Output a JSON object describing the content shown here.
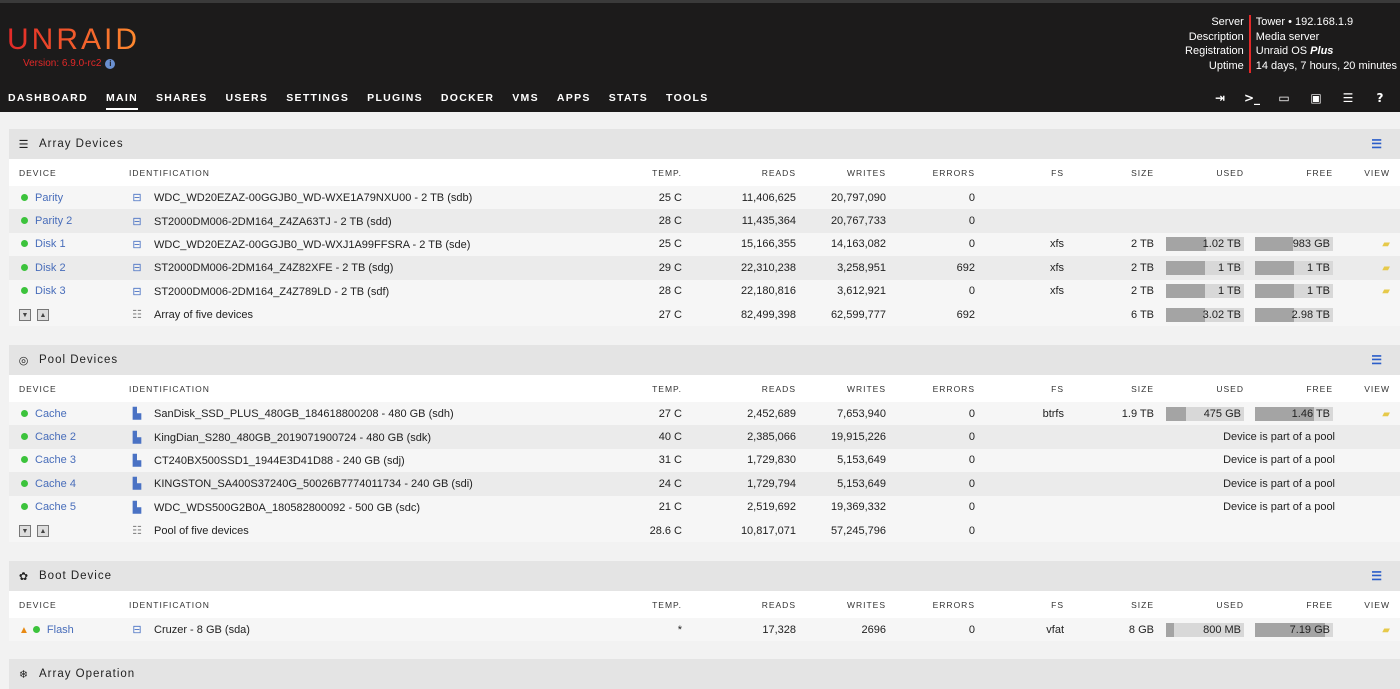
{
  "header": {
    "logo": "UNRAID",
    "version": "Version: 6.9.0-rc2",
    "server_labels": [
      "Server",
      "Description",
      "Registration",
      "Uptime"
    ],
    "server_values": [
      "Tower • 192.168.1.9",
      "Media server",
      "Unraid OS ",
      "14 days, 7 hours, 20 minutes"
    ],
    "registration_emphasis": "Plus"
  },
  "nav": {
    "items": [
      "DASHBOARD",
      "MAIN",
      "SHARES",
      "USERS",
      "SETTINGS",
      "PLUGINS",
      "DOCKER",
      "VMS",
      "APPS",
      "STATS",
      "TOOLS"
    ],
    "active": "MAIN",
    "icons": [
      "logout-icon",
      "terminal-icon",
      "feedback-icon",
      "webgui-icon",
      "log-icon",
      "help-icon"
    ]
  },
  "columns": [
    "DEVICE",
    "IDENTIFICATION",
    "TEMP.",
    "READS",
    "WRITES",
    "ERRORS",
    "FS",
    "SIZE",
    "USED",
    "FREE",
    "VIEW"
  ],
  "array": {
    "title": "Array Devices",
    "rows": [
      {
        "device": "Parity",
        "id": "WDC_WD20EZAZ-00GGJB0_WD-WXE1A79NXU00 - 2 TB (sdb)",
        "temp": "25 C",
        "reads": "11,406,625",
        "writes": "20,797,090",
        "errors": "0",
        "fs": "",
        "size": "",
        "used": "",
        "free": ""
      },
      {
        "device": "Parity 2",
        "id": "ST2000DM006-2DM164_Z4ZA63TJ - 2 TB (sdd)",
        "temp": "28 C",
        "reads": "11,435,364",
        "writes": "20,767,733",
        "errors": "0",
        "fs": "",
        "size": "",
        "used": "",
        "free": ""
      },
      {
        "device": "Disk 1",
        "id": "WDC_WD20EZAZ-00GGJB0_WD-WXJ1A99FFSRA - 2 TB (sde)",
        "temp": "25 C",
        "reads": "15,166,355",
        "writes": "14,163,082",
        "errors": "0",
        "fs": "xfs",
        "size": "2 TB",
        "used": "1.02 TB",
        "free": "983 GB",
        "used_pct": 51,
        "free_pct": 49
      },
      {
        "device": "Disk 2",
        "id": "ST2000DM006-2DM164_Z4Z82XFE - 2 TB (sdg)",
        "temp": "29 C",
        "reads": "22,310,238",
        "writes": "3,258,951",
        "errors": "692",
        "fs": "xfs",
        "size": "2 TB",
        "used": "1 TB",
        "free": "1 TB",
        "used_pct": 50,
        "free_pct": 50
      },
      {
        "device": "Disk 3",
        "id": "ST2000DM006-2DM164_Z4Z789LD - 2 TB (sdf)",
        "temp": "28 C",
        "reads": "22,180,816",
        "writes": "3,612,921",
        "errors": "0",
        "fs": "xfs",
        "size": "2 TB",
        "used": "1 TB",
        "free": "1 TB",
        "used_pct": 50,
        "free_pct": 50
      }
    ],
    "total": {
      "id": "Array of five devices",
      "temp": "27 C",
      "reads": "82,499,398",
      "writes": "62,599,777",
      "errors": "692",
      "size": "6 TB",
      "used": "3.02 TB",
      "free": "2.98 TB",
      "used_pct": 50,
      "free_pct": 50
    }
  },
  "pool": {
    "title": "Pool Devices",
    "rows": [
      {
        "device": "Cache",
        "id": "SanDisk_SSD_PLUS_480GB_184618800208 - 480 GB (sdh)",
        "temp": "27 C",
        "reads": "2,452,689",
        "writes": "7,653,940",
        "errors": "0",
        "fs": "btrfs",
        "size": "1.9 TB",
        "used": "475 GB",
        "free": "1.46 TB",
        "used_pct": 25,
        "free_pct": 75
      },
      {
        "device": "Cache 2",
        "id": "KingDian_S280_480GB_2019071900724 - 480 GB (sdk)",
        "temp": "40 C",
        "reads": "2,385,066",
        "writes": "19,915,226",
        "errors": "0",
        "note": "Device is part of a pool"
      },
      {
        "device": "Cache 3",
        "id": "CT240BX500SSD1_1944E3D41D88 - 240 GB (sdj)",
        "temp": "31 C",
        "reads": "1,729,830",
        "writes": "5,153,649",
        "errors": "0",
        "note": "Device is part of a pool"
      },
      {
        "device": "Cache 4",
        "id": "KINGSTON_SA400S37240G_50026B7774011734 - 240 GB (sdi)",
        "temp": "24 C",
        "reads": "1,729,794",
        "writes": "5,153,649",
        "errors": "0",
        "note": "Device is part of a pool"
      },
      {
        "device": "Cache 5",
        "id": "WDC_WDS500G2B0A_180582800092 - 500 GB (sdc)",
        "temp": "21 C",
        "reads": "2,519,692",
        "writes": "19,369,332",
        "errors": "0",
        "note": "Device is part of a pool"
      }
    ],
    "total": {
      "id": "Pool of five devices",
      "temp": "28.6 C",
      "reads": "10,817,071",
      "writes": "57,245,796",
      "errors": "0"
    }
  },
  "boot": {
    "title": "Boot Device",
    "row": {
      "device": "Flash",
      "id": "Cruzer - 8 GB (sda)",
      "temp": "*",
      "reads": "17,328",
      "writes": "2696",
      "errors": "0",
      "fs": "vfat",
      "size": "8 GB",
      "used": "800 MB",
      "free": "7.19 GB",
      "used_pct": 10,
      "free_pct": 90
    }
  },
  "operation": {
    "title": "Array Operation"
  }
}
